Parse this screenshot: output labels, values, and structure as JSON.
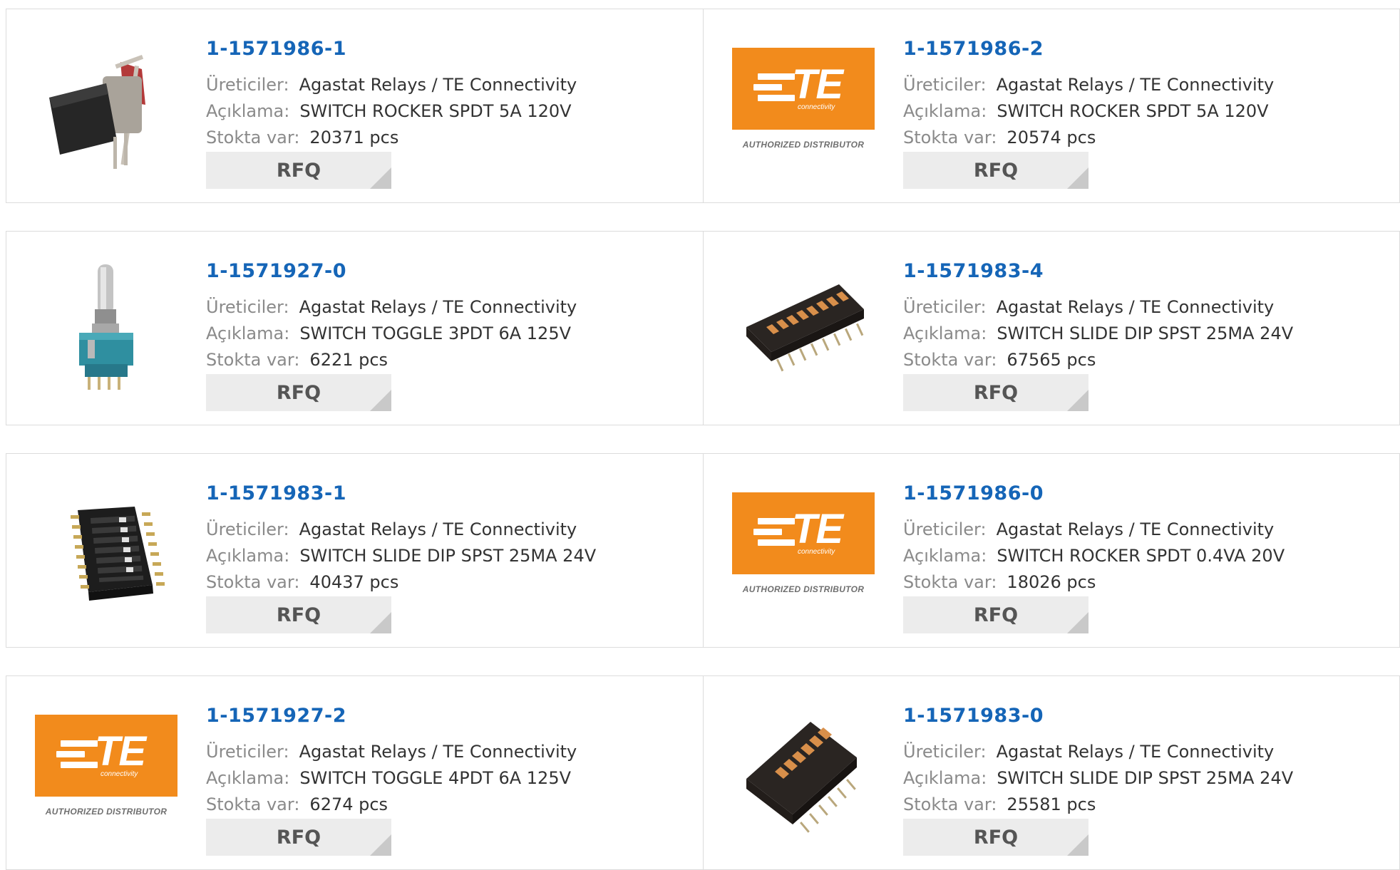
{
  "labels": {
    "manufacturer": "Üreticiler:",
    "description": "Açıklama:",
    "stock": "Stokta var:",
    "rfq": "RFQ"
  },
  "logo": {
    "brand": "TE",
    "tagline": "connectivity",
    "distributor": "AUTHORIZED DISTRIBUTOR",
    "color": "#f28b1c"
  },
  "products": [
    {
      "pn": "1-1571986-1",
      "manufacturer": "Agastat Relays / TE Connectivity",
      "description": "SWITCH ROCKER SPDT 5A 120V",
      "stock": "20371 pcs",
      "image": "rocker-switch"
    },
    {
      "pn": "1-1571986-2",
      "manufacturer": "Agastat Relays / TE Connectivity",
      "description": "SWITCH ROCKER SPDT 5A 120V",
      "stock": "20574 pcs",
      "image": "te-logo"
    },
    {
      "pn": "1-1571927-0",
      "manufacturer": "Agastat Relays / TE Connectivity",
      "description": "SWITCH TOGGLE 3PDT 6A 125V",
      "stock": "6221 pcs",
      "image": "toggle-switch"
    },
    {
      "pn": "1-1571983-4",
      "manufacturer": "Agastat Relays / TE Connectivity",
      "description": "SWITCH SLIDE DIP SPST 25MA 24V",
      "stock": "67565 pcs",
      "image": "dip-switch"
    },
    {
      "pn": "1-1571983-1",
      "manufacturer": "Agastat Relays / TE Connectivity",
      "description": "SWITCH SLIDE DIP SPST 25MA 24V",
      "stock": "40437 pcs",
      "image": "dip-switch-black"
    },
    {
      "pn": "1-1571986-0",
      "manufacturer": "Agastat Relays / TE Connectivity",
      "description": "SWITCH ROCKER SPDT 0.4VA 20V",
      "stock": "18026 pcs",
      "image": "te-logo"
    },
    {
      "pn": "1-1571927-2",
      "manufacturer": "Agastat Relays / TE Connectivity",
      "description": "SWITCH TOGGLE 4PDT 6A 125V",
      "stock": "6274 pcs",
      "image": "te-logo"
    },
    {
      "pn": "1-1571983-0",
      "manufacturer": "Agastat Relays / TE Connectivity",
      "description": "SWITCH SLIDE DIP SPST 25MA 24V",
      "stock": "25581 pcs",
      "image": "dip-switch"
    }
  ]
}
